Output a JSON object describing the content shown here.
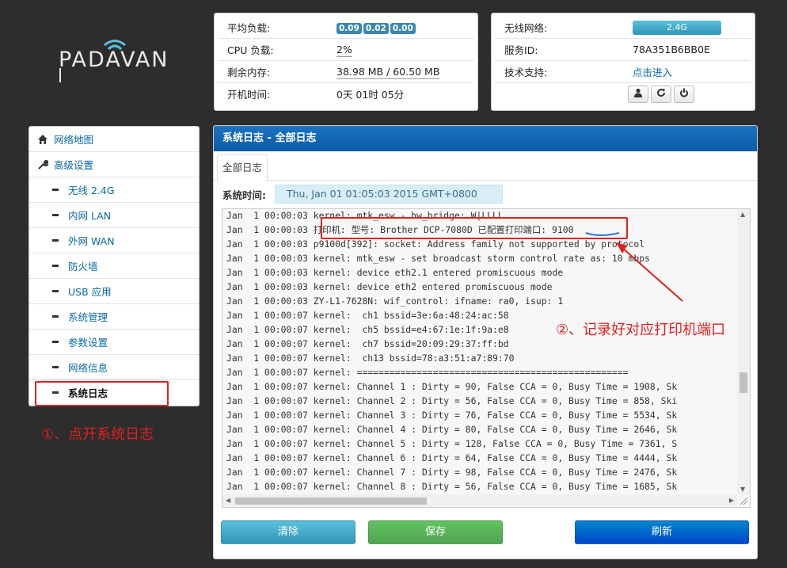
{
  "brand": {
    "logo_text": "PADAVAN"
  },
  "status": {
    "rows": [
      {
        "label": "平均负载:",
        "badges": [
          "0.09",
          "0.02",
          "0.00"
        ]
      },
      {
        "label": "CPU 负载:",
        "value": "2%"
      },
      {
        "label": "剩余内存:",
        "value": "38.98 MB / 60.50 MB"
      },
      {
        "label": "开机时间:",
        "value": "0天 01时 05分"
      }
    ]
  },
  "wireless": {
    "net_label": "无线网络:",
    "band": "2.4G",
    "service_label": "服务ID:",
    "service_id": "78A351B6BB0E",
    "support_label": "技术支持:",
    "support_link": "点击进入"
  },
  "nav": {
    "network_map": "网络地图",
    "advanced": "高级设置",
    "items": [
      "无线 2.4G",
      "内网 LAN",
      "外网 WAN",
      "防火墙",
      "USB 应用",
      "系统管理",
      "参数设置",
      "网络信息",
      "系统日志"
    ],
    "active_index": 8
  },
  "main": {
    "title": "系统日志 - 全部日志",
    "tab": "全部日志",
    "time_label": "系统时间:",
    "time_value": "Thu, Jan 01 01:05:03 2015 GMT+0800",
    "log_lines": [
      "Jan  1 00:00:03 kernel: mtk_esw - hw_bridge: W|LLLL",
      "Jan  1 00:00:03 打印机: 型号: Brother DCP-7080D 已配置打印端口: 9100",
      "Jan  1 00:00:03 p9100d[392]: socket: Address family not supported by protocol",
      "Jan  1 00:00:03 kernel: mtk_esw - set broadcast storm control rate as: 10 mbps",
      "Jan  1 00:00:03 kernel: device eth2.1 entered promiscuous mode",
      "Jan  1 00:00:03 kernel: device eth2 entered promiscuous mode",
      "Jan  1 00:00:03 ZY-L1-7628N: wif_control: ifname: ra0, isup: 1",
      "Jan  1 00:00:07 kernel:  ch1 bssid=3e:6a:48:24:ac:58",
      "Jan  1 00:00:07 kernel:  ch5 bssid=e4:67:1e:1f:9a:e8",
      "Jan  1 00:00:07 kernel:  ch7 bssid=20:09:29:37:ff:bd",
      "Jan  1 00:00:07 kernel:  ch13 bssid=78:a3:51:a7:89:70",
      "Jan  1 00:00:07 kernel: ==================================================",
      "Jan  1 00:00:07 kernel: Channel 1 : Dirty = 90, False CCA = 0, Busy Time = 1908, Sk",
      "Jan  1 00:00:07 kernel: Channel 2 : Dirty = 56, False CCA = 0, Busy Time = 858, Ski",
      "Jan  1 00:00:07 kernel: Channel 3 : Dirty = 76, False CCA = 0, Busy Time = 5534, Sk",
      "Jan  1 00:00:07 kernel: Channel 4 : Dirty = 80, False CCA = 0, Busy Time = 2646, Sk",
      "Jan  1 00:00:07 kernel: Channel 5 : Dirty = 128, False CCA = 0, Busy Time = 7361, S",
      "Jan  1 00:00:07 kernel: Channel 6 : Dirty = 64, False CCA = 0, Busy Time = 4444, Sk",
      "Jan  1 00:00:07 kernel: Channel 7 : Dirty = 98, False CCA = 0, Busy Time = 2476, Sk",
      "Jan  1 00:00:07 kernel: Channel 8 : Dirty = 56, False CCA = 0, Busy Time = 1685, Sk"
    ],
    "buttons": {
      "clear": "清除",
      "save": "保存",
      "refresh": "刷新"
    }
  },
  "annotations": {
    "step1": "①、点开系统日志",
    "step2": "②、记录好对应打印机端口",
    "color": "#e02020"
  }
}
